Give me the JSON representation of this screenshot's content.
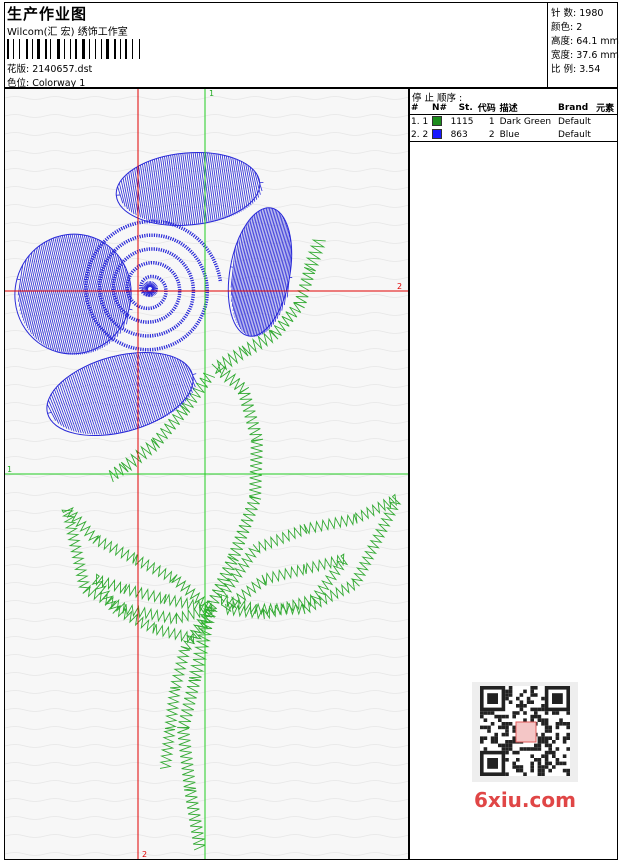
{
  "header": {
    "title": "生产作业图",
    "company": "Wilcom(汇 宏) 绣饰工作室",
    "design_line": "花版:  2140657.dst",
    "colorway_line": "色位:  Colorway 1"
  },
  "stats": {
    "stitches": "针 数:  1980",
    "colors": "颜色:  2",
    "height": "高度:  64.1 mm",
    "width": "宽度:  37.6 mm",
    "ratio": "比 例:  3.54"
  },
  "canvas": {
    "marker_top": "1",
    "marker_right": "2",
    "marker_left": "1",
    "marker_bottom": "2"
  },
  "stop_sequence": {
    "label": "停 止 顺序 :",
    "columns": [
      "#",
      "N#",
      "St.",
      "代码",
      "描述",
      "Brand",
      "元素"
    ],
    "rows": [
      {
        "idx": "1. 1",
        "stitches": "1115",
        "code": "1",
        "desc": "Dark Green",
        "brand": "Default",
        "color": "#1c8c1c"
      },
      {
        "idx": "2. 2",
        "stitches": "863",
        "code": "2",
        "desc": "Blue",
        "brand": "Default",
        "color": "#1a1aff"
      }
    ]
  },
  "watermark": {
    "text": "6xiu.com",
    "qr_icon": "qr-code-icon"
  },
  "colors": {
    "thread_green": "#33aa33",
    "thread_blue": "#2a2ad8",
    "guide_red": "#e00000",
    "guide_green": "#22cc22"
  }
}
